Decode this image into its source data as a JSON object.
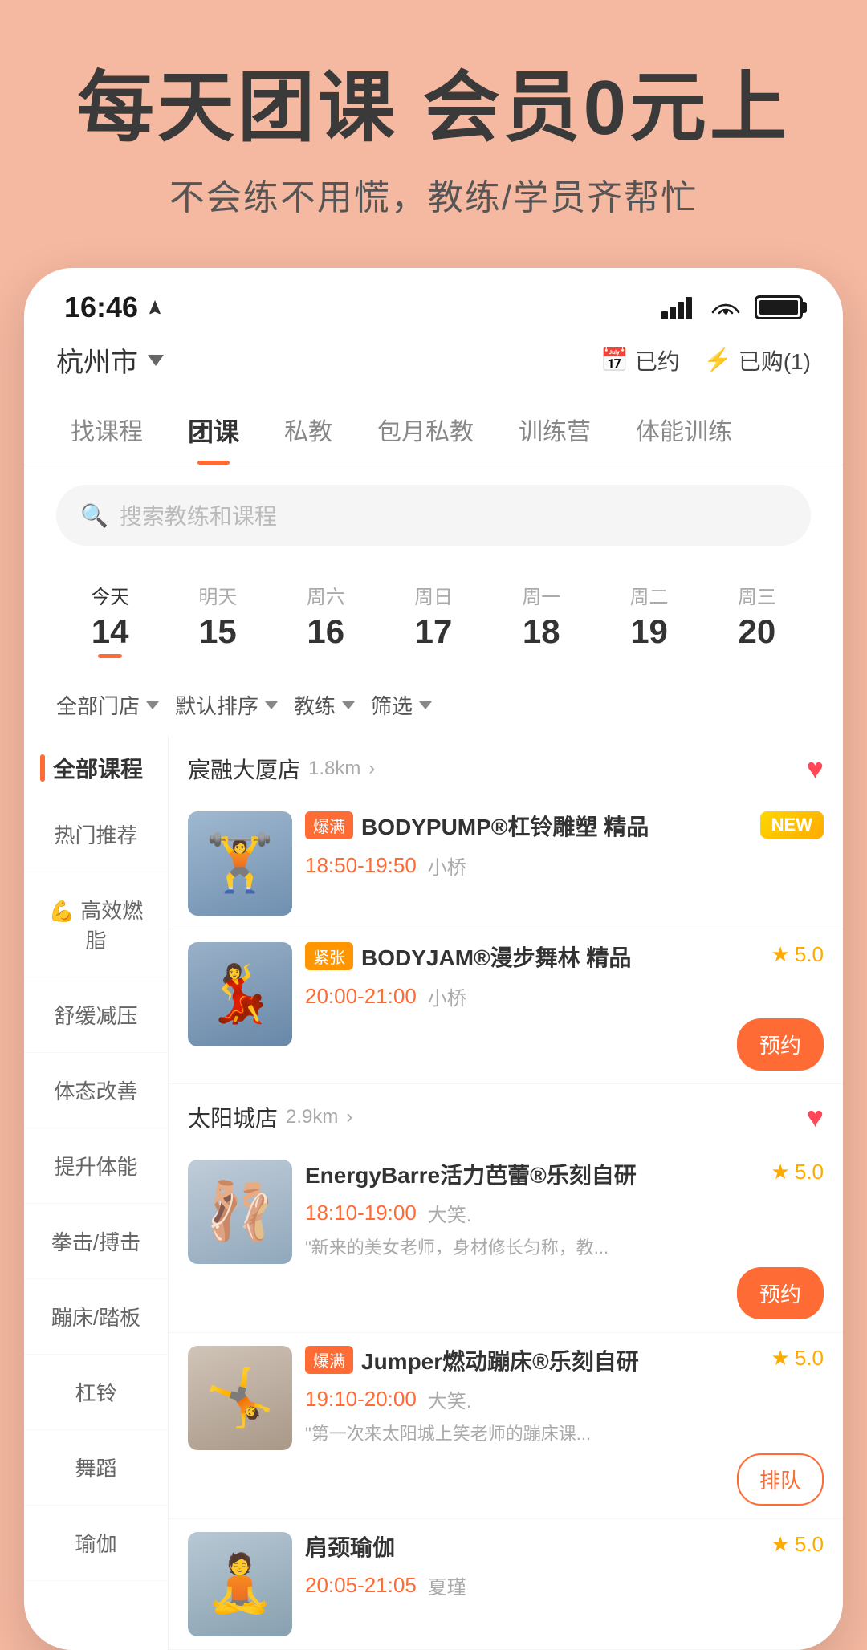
{
  "banner": {
    "title": "每天团课 会员0元上",
    "subtitle": "不会练不用慌，教练/学员齐帮忙"
  },
  "statusBar": {
    "time": "16:46",
    "locationIcon": "navigation-icon"
  },
  "header": {
    "location": "杭州市",
    "booked_label": "已约",
    "purchased_label": "已购(1)"
  },
  "navTabs": [
    {
      "label": "找课程",
      "active": false
    },
    {
      "label": "团课",
      "active": true
    },
    {
      "label": "私教",
      "active": false
    },
    {
      "label": "包月私教",
      "active": false
    },
    {
      "label": "训练营",
      "active": false
    },
    {
      "label": "体能训练",
      "active": false
    }
  ],
  "search": {
    "placeholder": "搜索教练和课程"
  },
  "dates": [
    {
      "dayName": "今天",
      "dayNum": "14",
      "active": true
    },
    {
      "dayName": "明天",
      "dayNum": "15",
      "active": false
    },
    {
      "dayName": "周六",
      "dayNum": "16",
      "active": false
    },
    {
      "dayName": "周日",
      "dayNum": "17",
      "active": false
    },
    {
      "dayName": "周一",
      "dayNum": "18",
      "active": false
    },
    {
      "dayName": "周二",
      "dayNum": "19",
      "active": false
    },
    {
      "dayName": "周三",
      "dayNum": "20",
      "active": false
    }
  ],
  "filters": [
    {
      "label": "全部门店"
    },
    {
      "label": "默认排序"
    },
    {
      "label": "教练"
    },
    {
      "label": "筛选"
    }
  ],
  "sidebar": {
    "sectionTitle": "全部课程",
    "items": [
      {
        "label": "热门推荐",
        "active": false
      },
      {
        "label": "💪 高效燃脂",
        "active": false
      },
      {
        "label": "舒缓减压",
        "active": false
      },
      {
        "label": "体态改善",
        "active": false
      },
      {
        "label": "提升体能",
        "active": false
      },
      {
        "label": "拳击/搏击",
        "active": false
      },
      {
        "label": "蹦床/踏板",
        "active": false
      },
      {
        "label": "杠铃",
        "active": false
      },
      {
        "label": "舞蹈",
        "active": false
      },
      {
        "label": "瑜伽",
        "active": false
      }
    ]
  },
  "stores": [
    {
      "name": "宸融大厦店",
      "distance": "1.8km",
      "favorited": true,
      "courses": [
        {
          "tag": "爆满",
          "tagType": "hot",
          "name": "BODYPUMP®杠铃雕塑 精品",
          "time": "18:50-19:50",
          "teacher": "小桥",
          "badge": "NEW",
          "badgeType": "new",
          "desc": "",
          "hasReserveBtn": false,
          "thumbColor": "#8fa8c8"
        },
        {
          "tag": "紧张",
          "tagType": "tight",
          "name": "BODYJAM®漫步舞林 精品",
          "time": "20:00-21:00",
          "teacher": "小桥",
          "rating": "5.0",
          "desc": "",
          "hasReserveBtn": true,
          "thumbColor": "#7a9ab8"
        }
      ]
    },
    {
      "name": "太阳城店",
      "distance": "2.9km",
      "favorited": true,
      "courses": [
        {
          "tag": "",
          "tagType": "",
          "name": "EnergyBarre活力芭蕾®乐刻自研",
          "time": "18:10-19:00",
          "teacher": "大笑.",
          "rating": "5.0",
          "desc": "\"新来的美女老师，身材修长匀称，教...",
          "hasReserveBtn": true,
          "thumbColor": "#b0c4d8"
        },
        {
          "tag": "爆满",
          "tagType": "hot",
          "name": "Jumper燃动蹦床®乐刻自研",
          "time": "19:10-20:00",
          "teacher": "大笑.",
          "rating": "5.0",
          "desc": "\"第一次来太阳城上笑老师的蹦床课...",
          "hasReserveBtn": false,
          "hasQueueBtn": true,
          "thumbColor": "#c4b8a8"
        },
        {
          "tag": "",
          "tagType": "",
          "name": "肩颈瑜伽",
          "time": "20:05-21:05",
          "teacher": "夏瑾",
          "rating": "5.0",
          "desc": "",
          "hasReserveBtn": true,
          "thumbColor": "#a8b8c4"
        }
      ]
    }
  ],
  "labels": {
    "reserve": "预约",
    "queue": "排队",
    "booked_icon": "📅",
    "purchased_icon": "⚡"
  }
}
